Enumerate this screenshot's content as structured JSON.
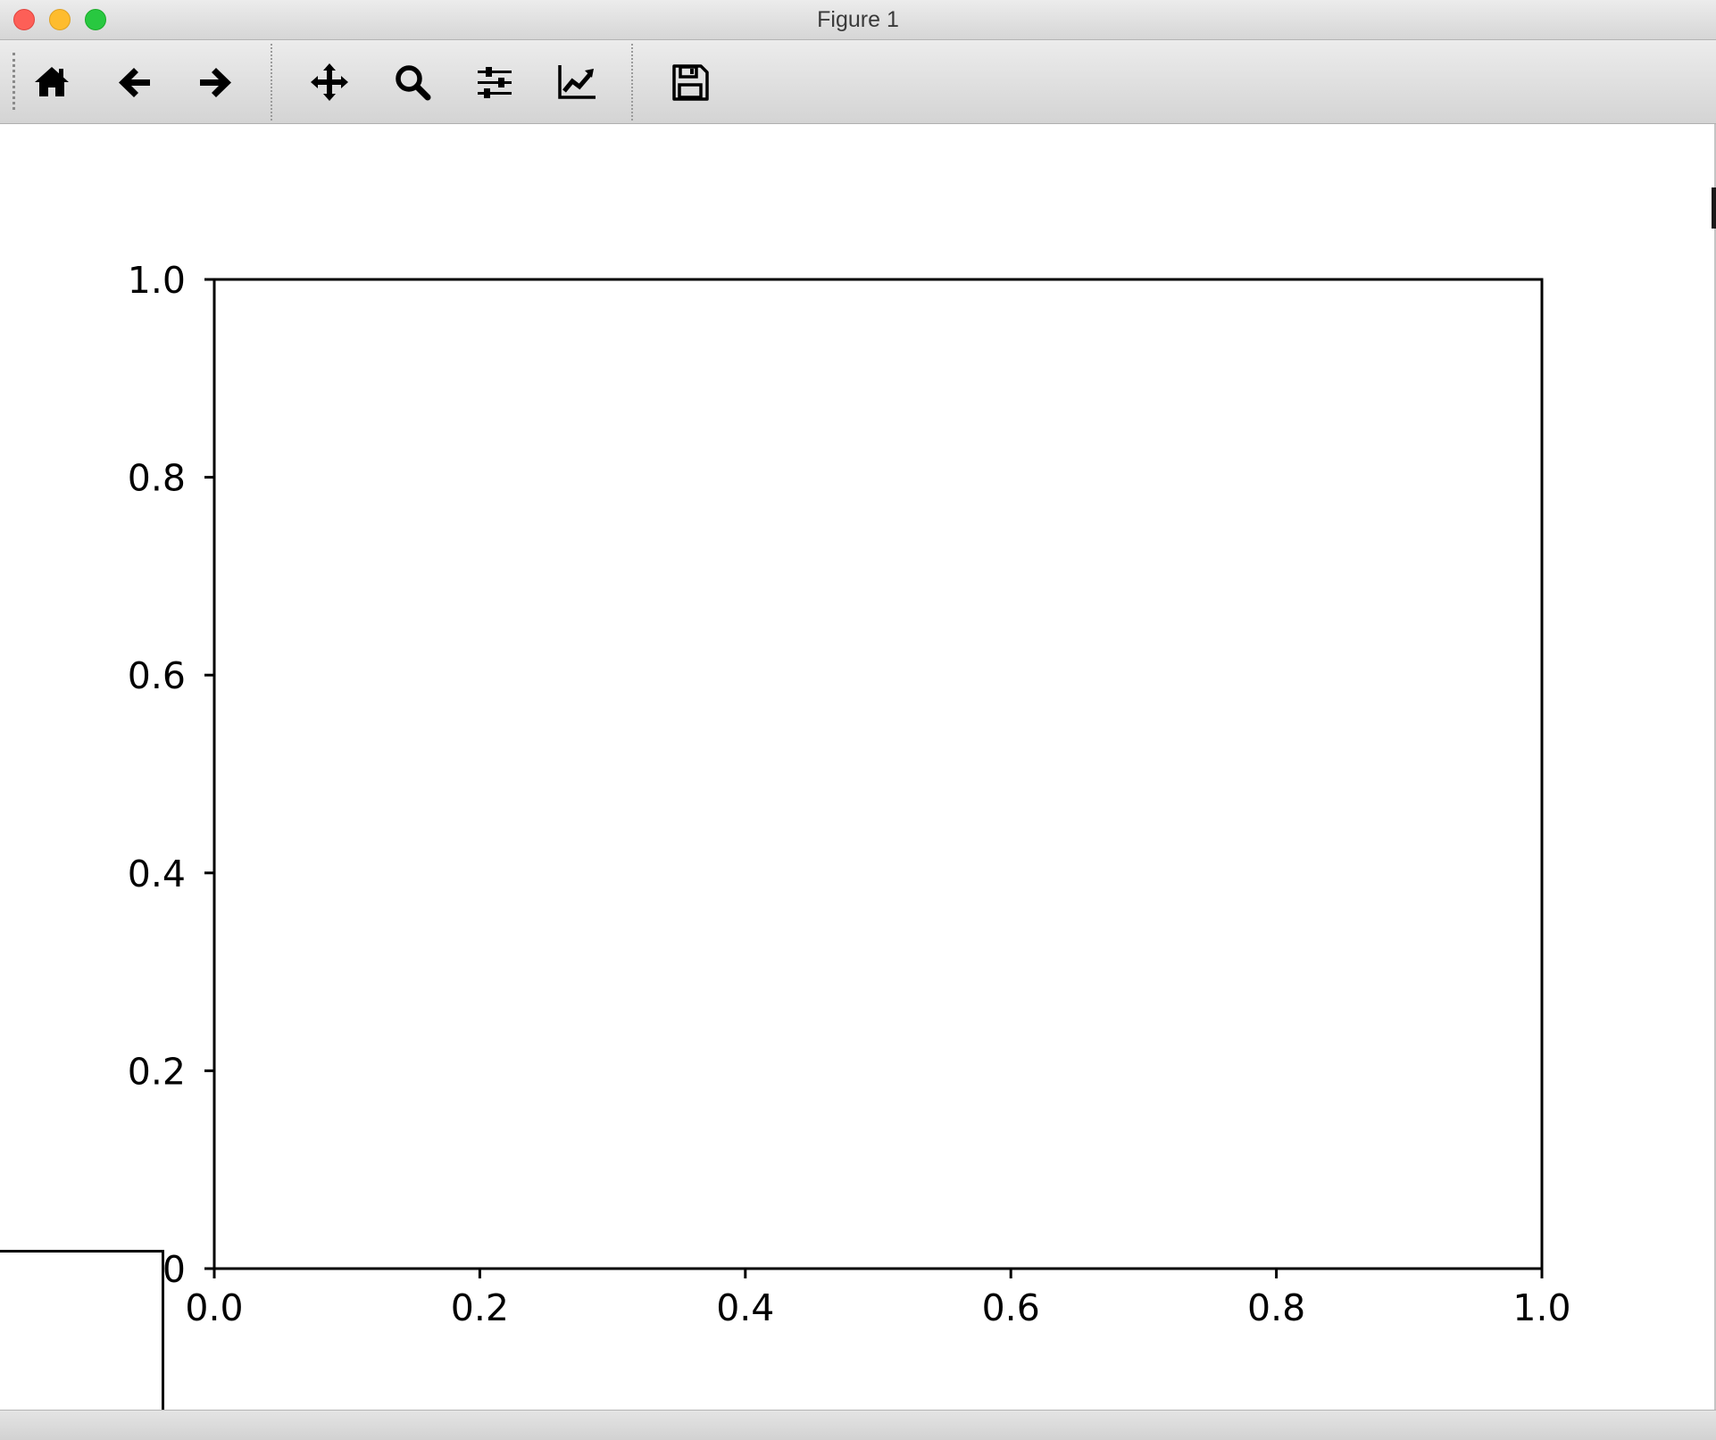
{
  "window": {
    "title": "Figure 1"
  },
  "toolbar": {
    "tools": [
      {
        "name": "home",
        "icon": "home-icon",
        "tooltip": "Reset original view"
      },
      {
        "name": "back",
        "icon": "arrow-left-icon",
        "tooltip": "Back to previous view"
      },
      {
        "name": "forward",
        "icon": "arrow-right-icon",
        "tooltip": "Forward to next view"
      },
      {
        "name": "pan",
        "icon": "move-icon",
        "tooltip": "Pan axes"
      },
      {
        "name": "zoom",
        "icon": "magnifier-icon",
        "tooltip": "Zoom to rectangle"
      },
      {
        "name": "subplots",
        "icon": "sliders-icon",
        "tooltip": "Configure subplots"
      },
      {
        "name": "customize",
        "icon": "line-chart-icon",
        "tooltip": "Edit axis, curve and image parameters"
      },
      {
        "name": "save",
        "icon": "floppy-disk-icon",
        "tooltip": "Save the figure"
      }
    ]
  },
  "chart_data": {
    "type": "line",
    "title": "",
    "xlabel": "",
    "ylabel": "",
    "xlim": [
      0.0,
      1.0
    ],
    "ylim": [
      0.0,
      1.0
    ],
    "xticks": [
      0.0,
      0.2,
      0.4,
      0.6,
      0.8,
      1.0
    ],
    "yticks": [
      0.0,
      0.2,
      0.4,
      0.6,
      0.8,
      1.0
    ],
    "xtick_labels": [
      "0.0",
      "0.2",
      "0.4",
      "0.6",
      "0.8",
      "1.0"
    ],
    "ytick_labels": [
      "0",
      "0.2",
      "0.4",
      "0.6",
      "0.8",
      "1.0"
    ],
    "series": [],
    "grid": false,
    "legend": "none",
    "spine_color": "#000000"
  },
  "colors": {
    "titlebar": "#e1e1e1",
    "toolbar": "#e0e0e0",
    "canvas": "#ffffff",
    "close": "#fd5f57",
    "minimize": "#febc2e",
    "maximize": "#28c840"
  }
}
